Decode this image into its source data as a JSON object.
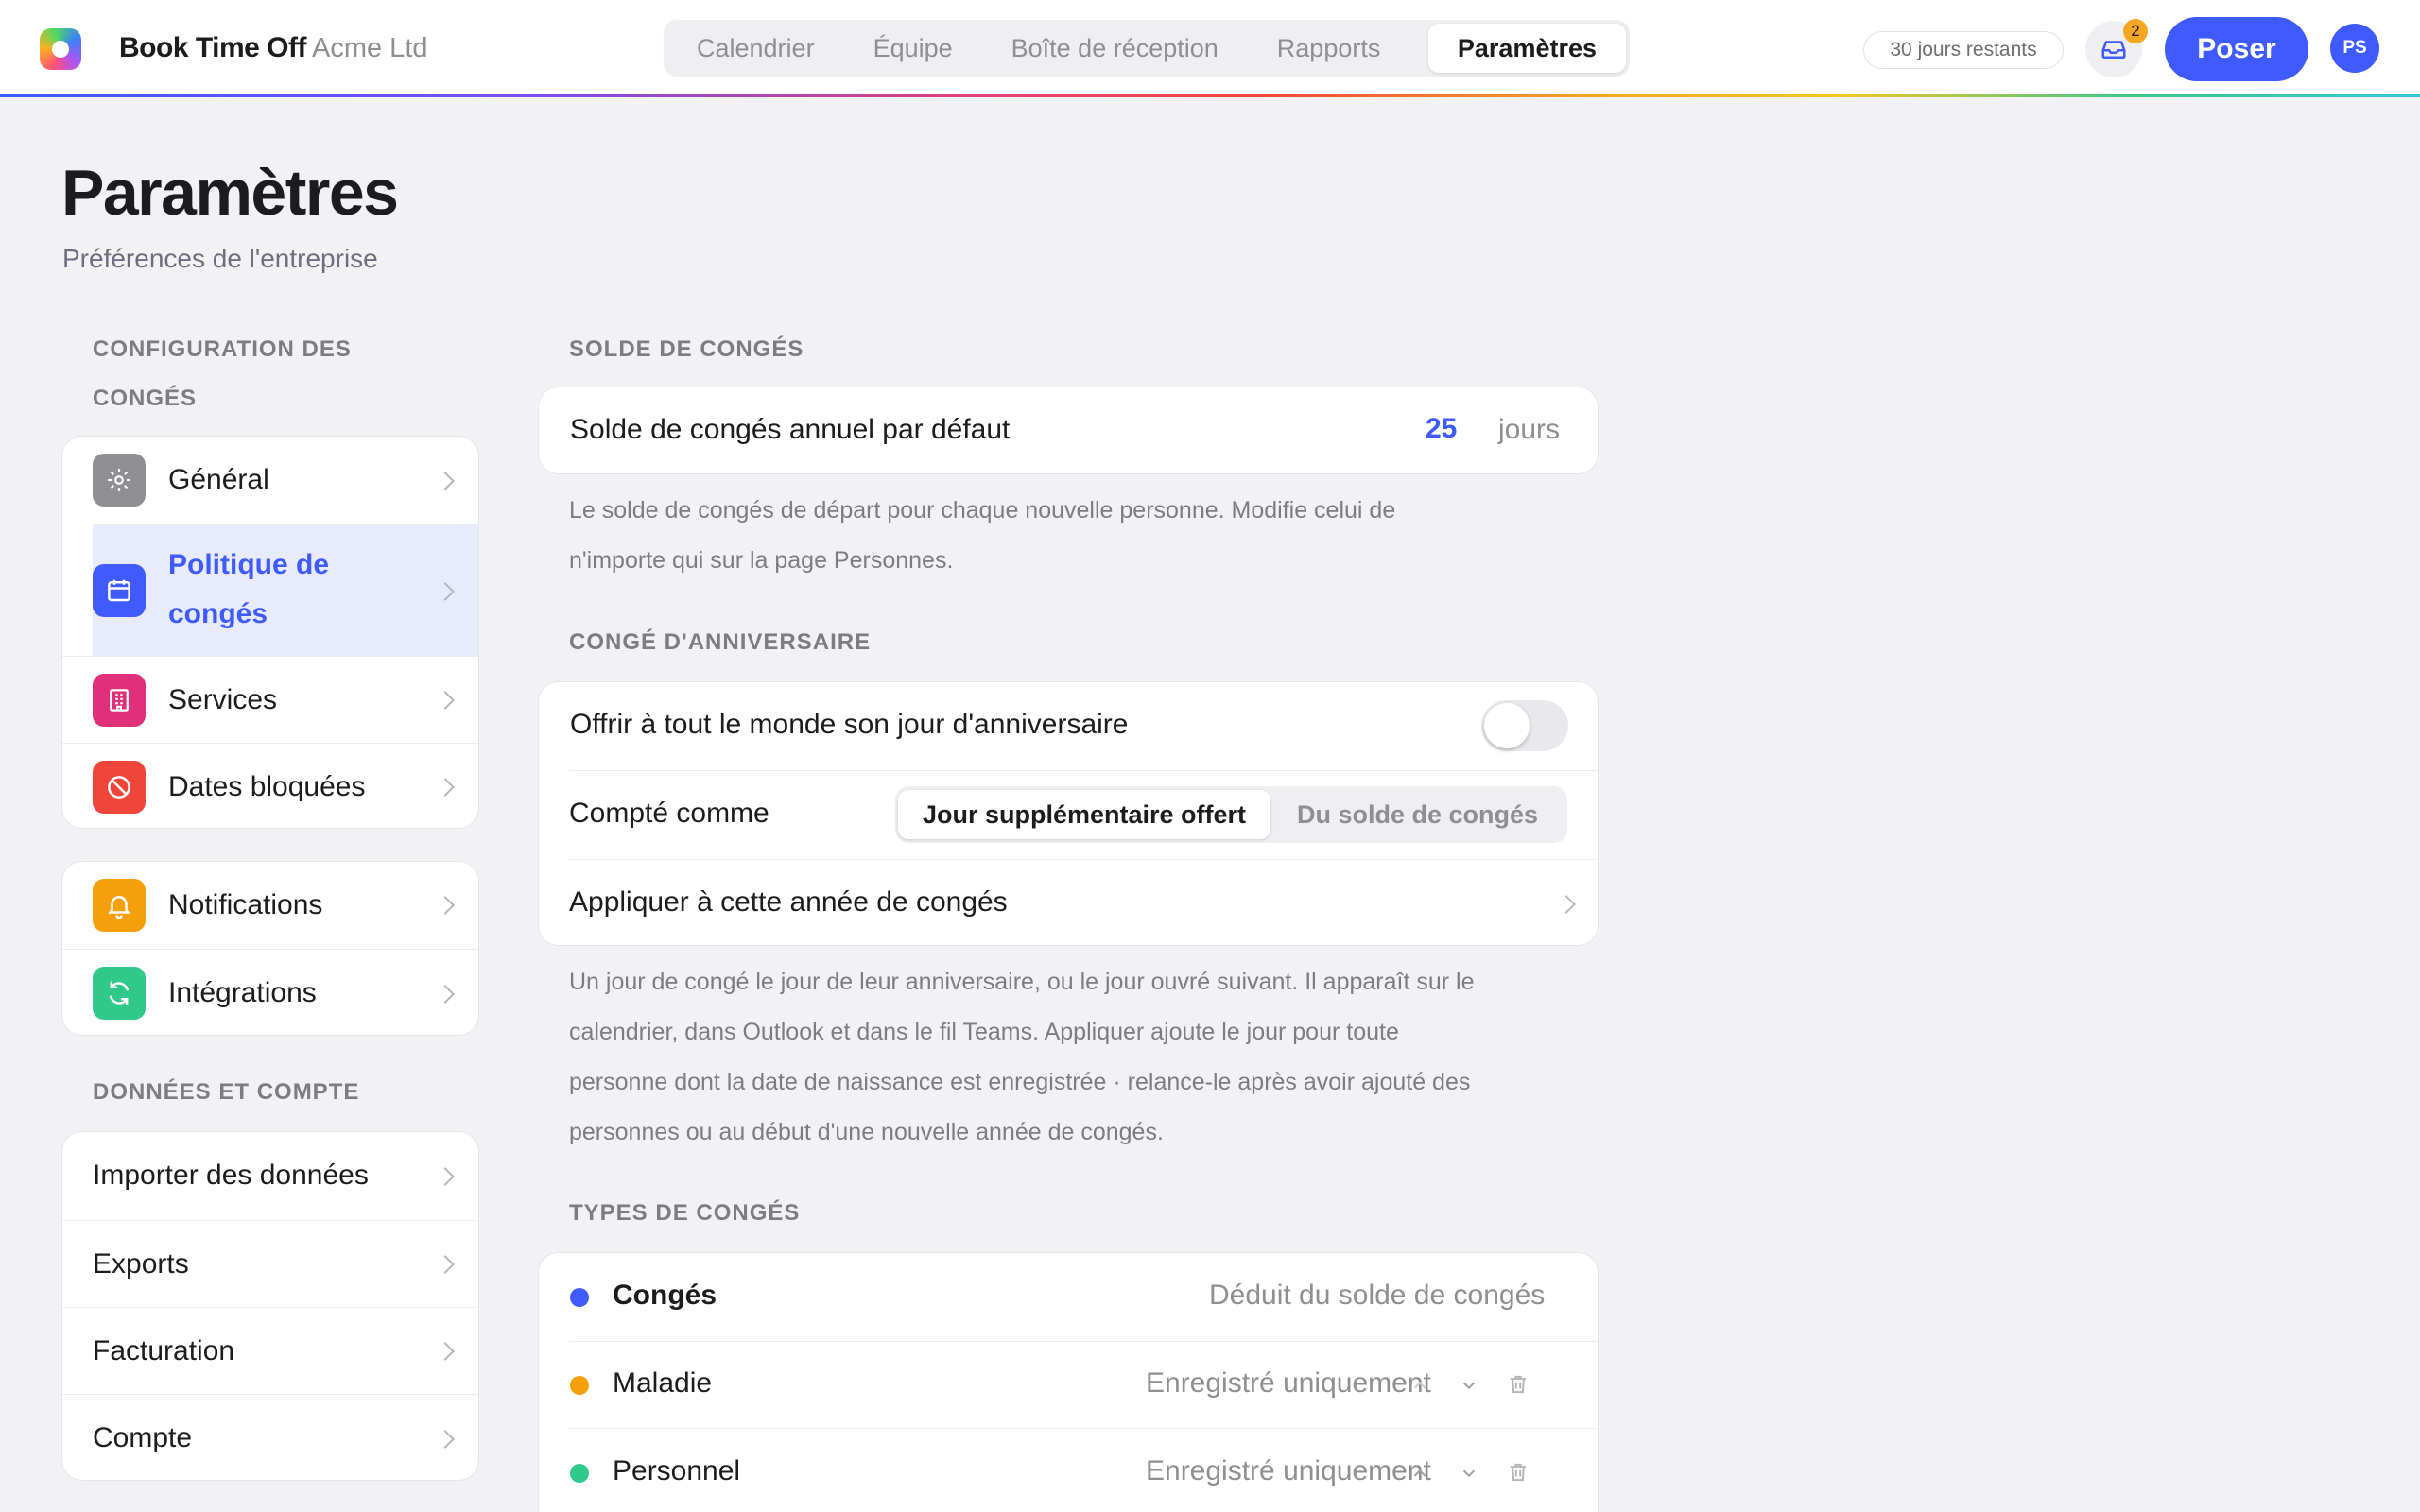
{
  "header": {
    "brand": "Book Time Off",
    "company": "Acme Ltd",
    "nav_tabs": [
      {
        "label": "Calendrier"
      },
      {
        "label": "Équipe"
      },
      {
        "label": "Boîte de réception"
      },
      {
        "label": "Rapports"
      },
      {
        "label": "Paramètres",
        "active": true
      }
    ],
    "days_remaining": "30 jours restants",
    "inbox_count": "2",
    "poser_label": "Poser",
    "avatar_initials": "PS"
  },
  "page": {
    "title": "Paramètres",
    "subtitle": "Préférences de l'entreprise"
  },
  "sidebar": {
    "section1_label": "CONFIGURATION DES CONGÉS",
    "group1": [
      {
        "label": "Général",
        "icon": "gear-icon",
        "color": "#8e8e93"
      },
      {
        "label": "Politique de congés",
        "icon": "calendar-icon",
        "color": "#3f5bff",
        "active": true
      },
      {
        "label": "Services",
        "icon": "building-icon",
        "color": "#e0307a"
      },
      {
        "label": "Dates bloquées",
        "icon": "block-icon",
        "color": "#f0453a"
      }
    ],
    "group2": [
      {
        "label": "Notifications",
        "icon": "bell-icon",
        "color": "#f5a00a"
      },
      {
        "label": "Intégrations",
        "icon": "refresh-icon",
        "color": "#2fc98a"
      }
    ],
    "section2_label": "DONNÉES ET COMPTE",
    "group3": [
      {
        "label": "Importer des données"
      },
      {
        "label": "Exports"
      },
      {
        "label": "Facturation"
      },
      {
        "label": "Compte"
      }
    ]
  },
  "main": {
    "balance": {
      "section_label": "SOLDE DE CONGÉS",
      "row_label": "Solde de congés annuel par défaut",
      "value": "25",
      "unit": "jours",
      "help": "Le solde de congés de départ pour chaque nouvelle personne. Modifie celui de n'importe qui sur la page Personnes."
    },
    "birthday": {
      "section_label": "CONGÉ D'ANNIVERSAIRE",
      "offer_label": "Offrir à tout le monde son jour d'anniversaire",
      "toggle_on": false,
      "counted_label": "Compté comme",
      "counted_options": [
        "Jour supplémentaire offert",
        "Du solde de congés"
      ],
      "counted_selected": "Jour supplémentaire offert",
      "apply_label": "Appliquer à cette année de congés",
      "help": "Un jour de congé le jour de leur anniversaire, ou le jour ouvré suivant. Il apparaît sur le calendrier, dans Outlook et dans le fil Teams. Appliquer ajoute le jour pour toute personne dont la date de naissance est enregistrée · relance-le après avoir ajouté des personnes ou au début d'une nouvelle année de congés."
    },
    "types": {
      "section_label": "TYPES DE CONGÉS",
      "items": [
        {
          "name": "Congés",
          "value": "Déduit du solde de congés",
          "color": "#3f5bff"
        },
        {
          "name": "Maladie",
          "value": "Enregistré uniquement",
          "color": "#f5a00a"
        },
        {
          "name": "Personnel",
          "value": "Enregistré uniquement",
          "color": "#2fc98a"
        }
      ]
    }
  },
  "colors": {
    "accent": "#3f5bff",
    "badge": "#f5a623"
  }
}
